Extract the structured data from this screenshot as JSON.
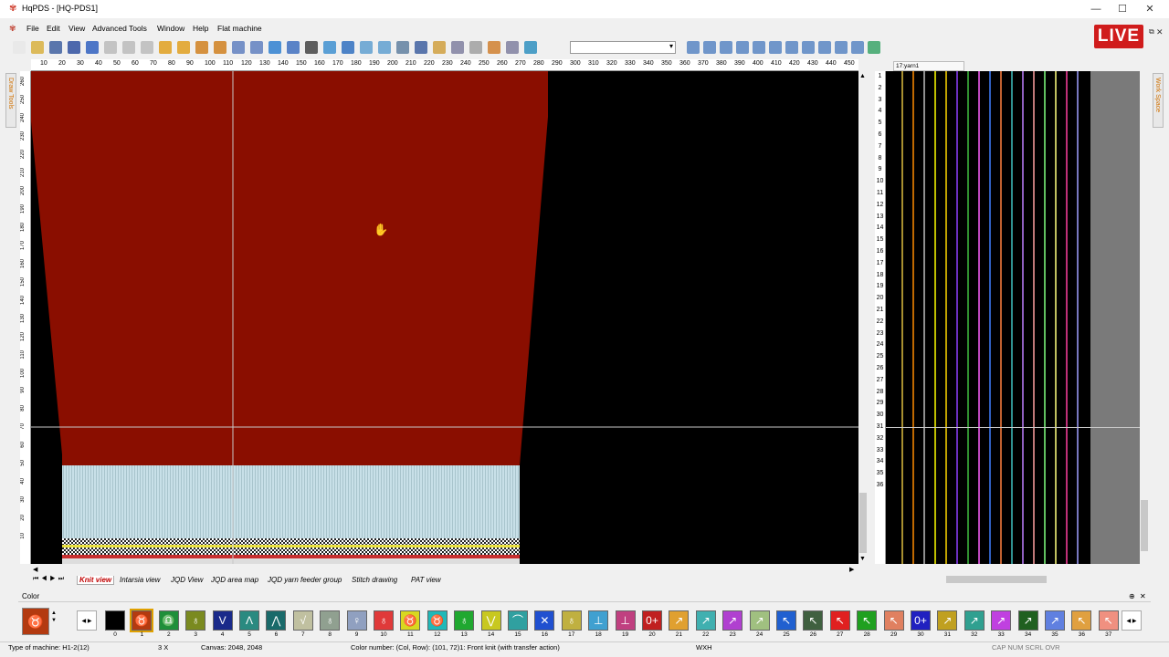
{
  "window": {
    "title": "HqPDS - [HQ-PDS1]",
    "minimize": "—",
    "maximize": "☐",
    "close": "✕"
  },
  "menu": [
    "File",
    "Edit",
    "View",
    "Advanced Tools",
    "Window",
    "Help",
    "Flat machine"
  ],
  "overlay_badge": "LIVE",
  "toolbar": {
    "zoom_value": ""
  },
  "side_tabs": {
    "left": "Draw Tools",
    "right": "Work Space"
  },
  "hruler_labels": [
    "10",
    "20",
    "30",
    "40",
    "50",
    "60",
    "70",
    "80",
    "90",
    "100",
    "110",
    "120",
    "130",
    "140",
    "150",
    "160",
    "170",
    "180",
    "190",
    "200",
    "210",
    "220",
    "230",
    "240",
    "250",
    "260",
    "270",
    "280",
    "290",
    "300",
    "310",
    "320",
    "330",
    "340",
    "350",
    "360",
    "370",
    "380",
    "390",
    "400",
    "410",
    "420",
    "430",
    "440",
    "450"
  ],
  "vruler_labels": [
    "260",
    "250",
    "240",
    "230",
    "220",
    "210",
    "200",
    "190",
    "180",
    "170",
    "160",
    "150",
    "140",
    "130",
    "120",
    "110",
    "100",
    "90",
    "80",
    "70",
    "60",
    "50",
    "40",
    "30",
    "20",
    "10"
  ],
  "view_tabs": [
    "Knit view",
    "Intarsia view",
    "JQD View",
    "JQD area map",
    "JQD yarn feeder group",
    "Stitch drawing",
    "PAT view"
  ],
  "yarn_panel": {
    "combo_label": "17:yarn1",
    "row_numbers": [
      "1",
      "2",
      "3",
      "4",
      "5",
      "6",
      "7",
      "8",
      "9",
      "10",
      "11",
      "12",
      "13",
      "14",
      "15",
      "16",
      "17",
      "18",
      "19",
      "20",
      "21",
      "22",
      "23",
      "24",
      "25",
      "26",
      "27",
      "28",
      "29",
      "30",
      "31",
      "32",
      "33",
      "34",
      "35",
      "36"
    ],
    "yarn_colors": [
      "#e0c040",
      "#ff8c00",
      "#c0c0c0",
      "#ffff00",
      "#ffd700",
      "#9040ff",
      "#40c040",
      "#ff60ff",
      "#4080ff",
      "#ff8040",
      "#40c0c0",
      "#c080ff",
      "#ffa0a0",
      "#80ff80",
      "#ffff80",
      "#ff40a0",
      "#a0a0ff"
    ]
  },
  "color_panel": {
    "title": "Color",
    "swatches": [
      {
        "num": "0",
        "color": "#000000",
        "glyph": ""
      },
      {
        "num": "1",
        "color": "#b33a10",
        "glyph": "♉"
      },
      {
        "num": "2",
        "color": "#1f8f3a",
        "glyph": "♎"
      },
      {
        "num": "3",
        "color": "#7a8a20",
        "glyph": "♁"
      },
      {
        "num": "4",
        "color": "#1a2a8a",
        "glyph": "V"
      },
      {
        "num": "5",
        "color": "#2a8a80",
        "glyph": "Λ"
      },
      {
        "num": "6",
        "color": "#1a6a6a",
        "glyph": "⋀"
      },
      {
        "num": "7",
        "color": "#c0c0a0",
        "glyph": "√"
      },
      {
        "num": "8",
        "color": "#90a090",
        "glyph": "♁"
      },
      {
        "num": "9",
        "color": "#90a0c0",
        "glyph": "♀"
      },
      {
        "num": "10",
        "color": "#e03a3a",
        "glyph": "♁"
      },
      {
        "num": "11",
        "color": "#d8d820",
        "glyph": "♉"
      },
      {
        "num": "12",
        "color": "#20b8b8",
        "glyph": "♉"
      },
      {
        "num": "13",
        "color": "#20a830",
        "glyph": "♁"
      },
      {
        "num": "14",
        "color": "#c8c820",
        "glyph": "⋁"
      },
      {
        "num": "15",
        "color": "#30a0a0",
        "glyph": "⌒"
      },
      {
        "num": "16",
        "color": "#2050d0",
        "glyph": "✕"
      },
      {
        "num": "17",
        "color": "#c0b040",
        "glyph": "♁"
      },
      {
        "num": "18",
        "color": "#40a0d0",
        "glyph": "⊥"
      },
      {
        "num": "19",
        "color": "#c04080",
        "glyph": "⊥"
      },
      {
        "num": "20",
        "color": "#c02020",
        "glyph": "0+"
      },
      {
        "num": "21",
        "color": "#e0a030",
        "glyph": "↗"
      },
      {
        "num": "22",
        "color": "#40b0b0",
        "glyph": "↗"
      },
      {
        "num": "23",
        "color": "#b040d0",
        "glyph": "↗"
      },
      {
        "num": "24",
        "color": "#a0c080",
        "glyph": "↗"
      },
      {
        "num": "25",
        "color": "#2060d0",
        "glyph": "↖"
      },
      {
        "num": "26",
        "color": "#406040",
        "glyph": "↖"
      },
      {
        "num": "27",
        "color": "#e02020",
        "glyph": "↖"
      },
      {
        "num": "28",
        "color": "#20a020",
        "glyph": "↖"
      },
      {
        "num": "29",
        "color": "#e08060",
        "glyph": "↖"
      },
      {
        "num": "30",
        "color": "#2020c0",
        "glyph": "0+"
      },
      {
        "num": "31",
        "color": "#c0a020",
        "glyph": "↗"
      },
      {
        "num": "32",
        "color": "#30a090",
        "glyph": "↗"
      },
      {
        "num": "33",
        "color": "#c040e0",
        "glyph": "↗"
      },
      {
        "num": "34",
        "color": "#206020",
        "glyph": "↗"
      },
      {
        "num": "35",
        "color": "#6080e0",
        "glyph": "↗"
      },
      {
        "num": "36",
        "color": "#e0a040",
        "glyph": "↖"
      },
      {
        "num": "37",
        "color": "#f09080",
        "glyph": "↖"
      }
    ]
  },
  "status": {
    "machine": "Type of machine: H1-2(12)",
    "zoom": "3 X",
    "canvas": "Canvas: 2048, 2048",
    "color_info": "Color number: (Col, Row): (101, 72)1: Front knit (with transfer action)",
    "dims": "WXH",
    "flags": "CAP  NUM  SCRL  OVR"
  }
}
